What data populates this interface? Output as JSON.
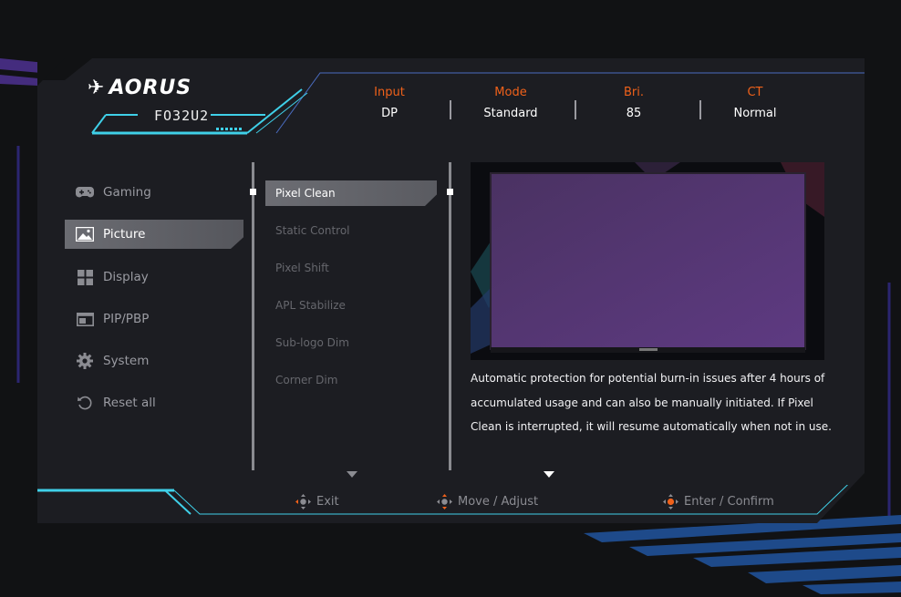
{
  "header": {
    "brand": "AORUS",
    "model": "FO32U2",
    "status": [
      {
        "label": "Input",
        "value": "DP"
      },
      {
        "label": "Mode",
        "value": "Standard"
      },
      {
        "label": "Bri.",
        "value": "85"
      },
      {
        "label": "CT",
        "value": "Normal"
      }
    ]
  },
  "categories": [
    {
      "label": "Gaming",
      "icon": "gamepad-icon",
      "active": false
    },
    {
      "label": "Picture",
      "icon": "picture-icon",
      "active": true
    },
    {
      "label": "Display",
      "icon": "display-grid-icon",
      "active": false
    },
    {
      "label": "PIP/PBP",
      "icon": "pip-icon",
      "active": false
    },
    {
      "label": "System",
      "icon": "gear-icon",
      "active": false
    },
    {
      "label": "Reset all",
      "icon": "reset-icon",
      "active": false
    }
  ],
  "submenu": [
    {
      "label": "Pixel Clean",
      "active": true
    },
    {
      "label": "Static Control",
      "active": false
    },
    {
      "label": "Pixel Shift",
      "active": false
    },
    {
      "label": "APL Stabilize",
      "active": false
    },
    {
      "label": "Sub-logo Dim",
      "active": false
    },
    {
      "label": "Corner Dim",
      "active": false
    }
  ],
  "description": "Automatic protection for potential burn-in issues after 4 hours of accumulated usage and can also be manually initiated. If Pixel Clean is interrupted, it will resume automatically when not in use.",
  "footer": {
    "exit": "Exit",
    "move": "Move / Adjust",
    "confirm": "Enter / Confirm"
  },
  "colors": {
    "accent_orange": "#f0611a",
    "accent_cyan": "#3fd0e8",
    "accent_magenta": "#e0309a",
    "panel_bg": "#1c1d22"
  }
}
